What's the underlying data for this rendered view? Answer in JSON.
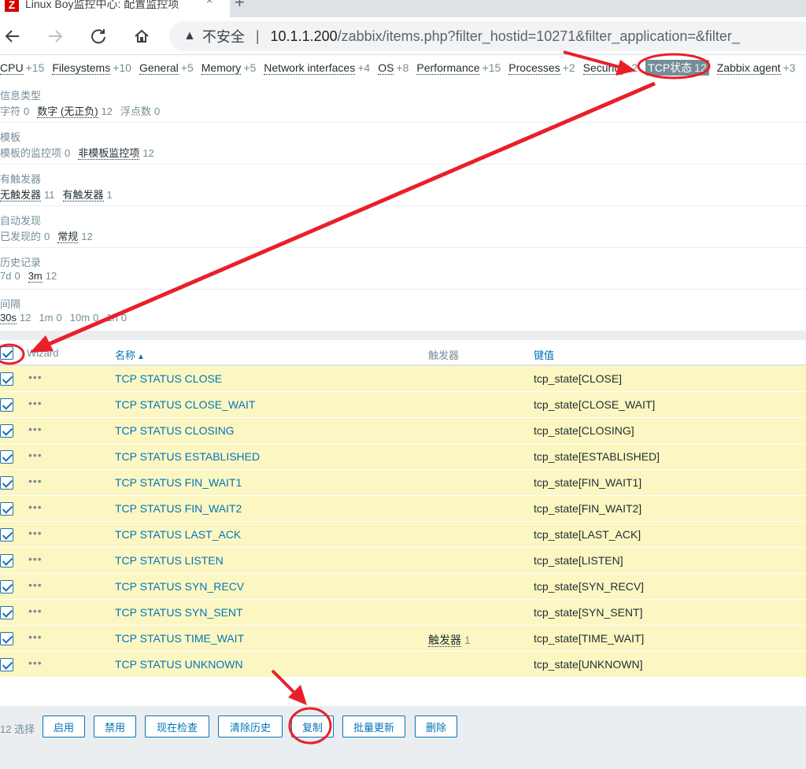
{
  "browser": {
    "tab_title": "Linux Boy监控中心: 配置监控项",
    "tab_close": "×",
    "new_tab": "+",
    "insecure_label": "不安全",
    "separator": "|",
    "url_host": "10.1.1.200",
    "url_path": "/zabbix/items.php?filter_hostid=10271&filter_application=&filter_"
  },
  "tags": [
    {
      "label": "CPU",
      "count": "+15"
    },
    {
      "label": "Filesystems",
      "count": "+10"
    },
    {
      "label": "General",
      "count": "+5"
    },
    {
      "label": "Memory",
      "count": "+5"
    },
    {
      "label": "Network interfaces",
      "count": "+4"
    },
    {
      "label": "OS",
      "count": "+8"
    },
    {
      "label": "Performance",
      "count": "+15"
    },
    {
      "label": "Processes",
      "count": "+2"
    },
    {
      "label": "Security",
      "count": "+2"
    },
    {
      "label": "TCP状态",
      "count": "12"
    },
    {
      "label": "Zabbix agent",
      "count": "+3"
    }
  ],
  "filter_groups": [
    {
      "title": "信息类型",
      "options": [
        {
          "label": "字符",
          "count": "0"
        },
        {
          "label": "数字 (无正负)",
          "count": "12"
        },
        {
          "label": "浮点数",
          "count": "0"
        }
      ]
    },
    {
      "title": "模板",
      "options": [
        {
          "label": "模板的监控项",
          "count": "0"
        },
        {
          "label": "非模板监控项",
          "count": "12"
        }
      ]
    },
    {
      "title": "有触发器",
      "options": [
        {
          "label": "无触发器",
          "count": "11"
        },
        {
          "label": "有触发器",
          "count": "1"
        }
      ]
    },
    {
      "title": "自动发现",
      "options": [
        {
          "label": "已发现的",
          "count": "0"
        },
        {
          "label": "常规",
          "count": "12"
        }
      ]
    },
    {
      "title": "历史记录",
      "options": [
        {
          "label": "7d",
          "count": "0"
        },
        {
          "label": "3m",
          "count": "12"
        }
      ]
    },
    {
      "title": "间隔",
      "options": [
        {
          "label": "30s",
          "count": "12"
        },
        {
          "label": "1m",
          "count": "0"
        },
        {
          "label": "10m",
          "count": "0"
        },
        {
          "label": "1h",
          "count": "0"
        }
      ]
    }
  ],
  "table": {
    "headers": {
      "wizard": "Wizard",
      "name": "名称",
      "sort_indicator": "▲",
      "triggers": "触发器",
      "key": "键值"
    },
    "row_menu": "•••",
    "rows": [
      {
        "name": "TCP STATUS CLOSE",
        "trigger": "",
        "trigger_count": "",
        "key": "tcp_state[CLOSE]"
      },
      {
        "name": "TCP STATUS CLOSE_WAIT",
        "trigger": "",
        "trigger_count": "",
        "key": "tcp_state[CLOSE_WAIT]"
      },
      {
        "name": "TCP STATUS CLOSING",
        "trigger": "",
        "trigger_count": "",
        "key": "tcp_state[CLOSING]"
      },
      {
        "name": "TCP STATUS ESTABLISHED",
        "trigger": "",
        "trigger_count": "",
        "key": "tcp_state[ESTABLISHED]"
      },
      {
        "name": "TCP STATUS FIN_WAIT1",
        "trigger": "",
        "trigger_count": "",
        "key": "tcp_state[FIN_WAIT1]"
      },
      {
        "name": "TCP STATUS FIN_WAIT2",
        "trigger": "",
        "trigger_count": "",
        "key": "tcp_state[FIN_WAIT2]"
      },
      {
        "name": "TCP STATUS LAST_ACK",
        "trigger": "",
        "trigger_count": "",
        "key": "tcp_state[LAST_ACK]"
      },
      {
        "name": "TCP STATUS LISTEN",
        "trigger": "",
        "trigger_count": "",
        "key": "tcp_state[LISTEN]"
      },
      {
        "name": "TCP STATUS SYN_RECV",
        "trigger": "",
        "trigger_count": "",
        "key": "tcp_state[SYN_RECV]"
      },
      {
        "name": "TCP STATUS SYN_SENT",
        "trigger": "",
        "trigger_count": "",
        "key": "tcp_state[SYN_SENT]"
      },
      {
        "name": "TCP STATUS TIME_WAIT",
        "trigger": "触发器",
        "trigger_count": "1",
        "key": "tcp_state[TIME_WAIT]"
      },
      {
        "name": "TCP STATUS UNKNOWN",
        "trigger": "",
        "trigger_count": "",
        "key": "tcp_state[UNKNOWN]"
      }
    ]
  },
  "footer": {
    "selected": "12 选择",
    "buttons": [
      "启用",
      "禁用",
      "现在检查",
      "清除历史",
      "复制",
      "批量更新",
      "删除"
    ]
  },
  "colors": {
    "link": "#0275b8",
    "selected_row": "#fcf7c2",
    "annotation": "#e8202a",
    "selected_tag": "#768d99"
  }
}
